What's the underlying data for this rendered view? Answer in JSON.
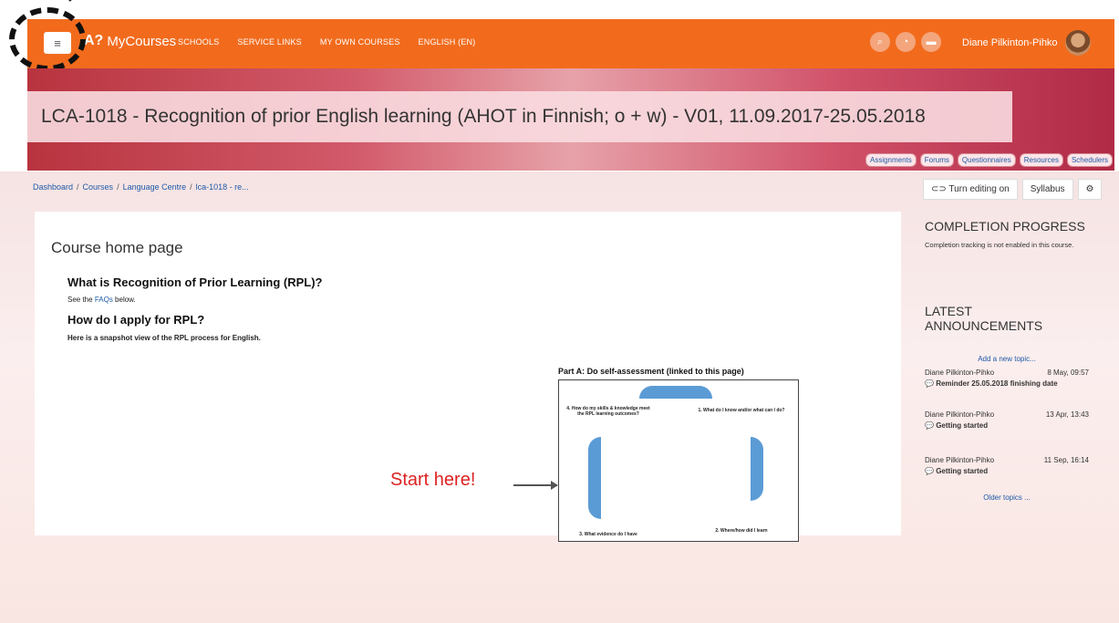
{
  "nav": {
    "menu_icon": "hamburger-icon",
    "brand": "MyCourses",
    "links": [
      "SCHOOLS",
      "SERVICE LINKS",
      "MY OWN COURSES",
      "ENGLISH (EN)"
    ],
    "icons": [
      "search-icon",
      "notifications-icon",
      "messages-icon"
    ],
    "user": "Diane Pilkinton-Pihko"
  },
  "course": {
    "title": "LCA-1018 - Recognition of prior English learning (AHOT in Finnish; o + w) - V01, 11.09.2017-25.05.2018",
    "tabs": [
      "Assignments",
      "Forums",
      "Questionnaires",
      "Resources",
      "Schedulers"
    ]
  },
  "breadcrumb": [
    "Dashboard",
    "Courses",
    "Language Centre",
    "lca-1018 - re..."
  ],
  "actions": {
    "editing": "Turn editing on",
    "syllabus": "Syllabus",
    "settings_icon": "gear-icon",
    "toggle_icon": "toggle-icon"
  },
  "content": {
    "heading": "Course home page",
    "q1": "What is Recognition of Prior Learning (RPL)?",
    "see_pre": "See the ",
    "see_link": "FAQs",
    "see_post": " below.",
    "q2": "How do I apply for RPL?",
    "snapshot": "Here is a snapshot view of the RPL process for English.",
    "diagram_caption": "Part A: Do self-assessment (linked to this page)",
    "step1": "1. What do I know and/or what can I do?",
    "step2": "2. Where/how did I learn",
    "step3": "3. What evidence do I have",
    "step4": "4. How do my skills & knowledge meet the RPL learning outcomes?",
    "start_here": "Start here!"
  },
  "sidebar": {
    "completion_title": "COMPLETION PROGRESS",
    "completion_text": "Completion tracking is not enabled in this course.",
    "announcements_title_1": "LATEST",
    "announcements_title_2": "ANNOUNCEMENTS",
    "add_topic": "Add a new topic...",
    "items": [
      {
        "author": "Diane Pilkinton-Pihko",
        "date": "8 May, 09:57",
        "topic": "Reminder 25.05.2018 finishing date"
      },
      {
        "author": "Diane Pilkinton-Pihko",
        "date": "13 Apr, 13:43",
        "topic": "Getting started"
      },
      {
        "author": "Diane Pilkinton-Pihko",
        "date": "11 Sep, 16:14",
        "topic": "Getting started"
      }
    ],
    "older": "Older topics ..."
  }
}
